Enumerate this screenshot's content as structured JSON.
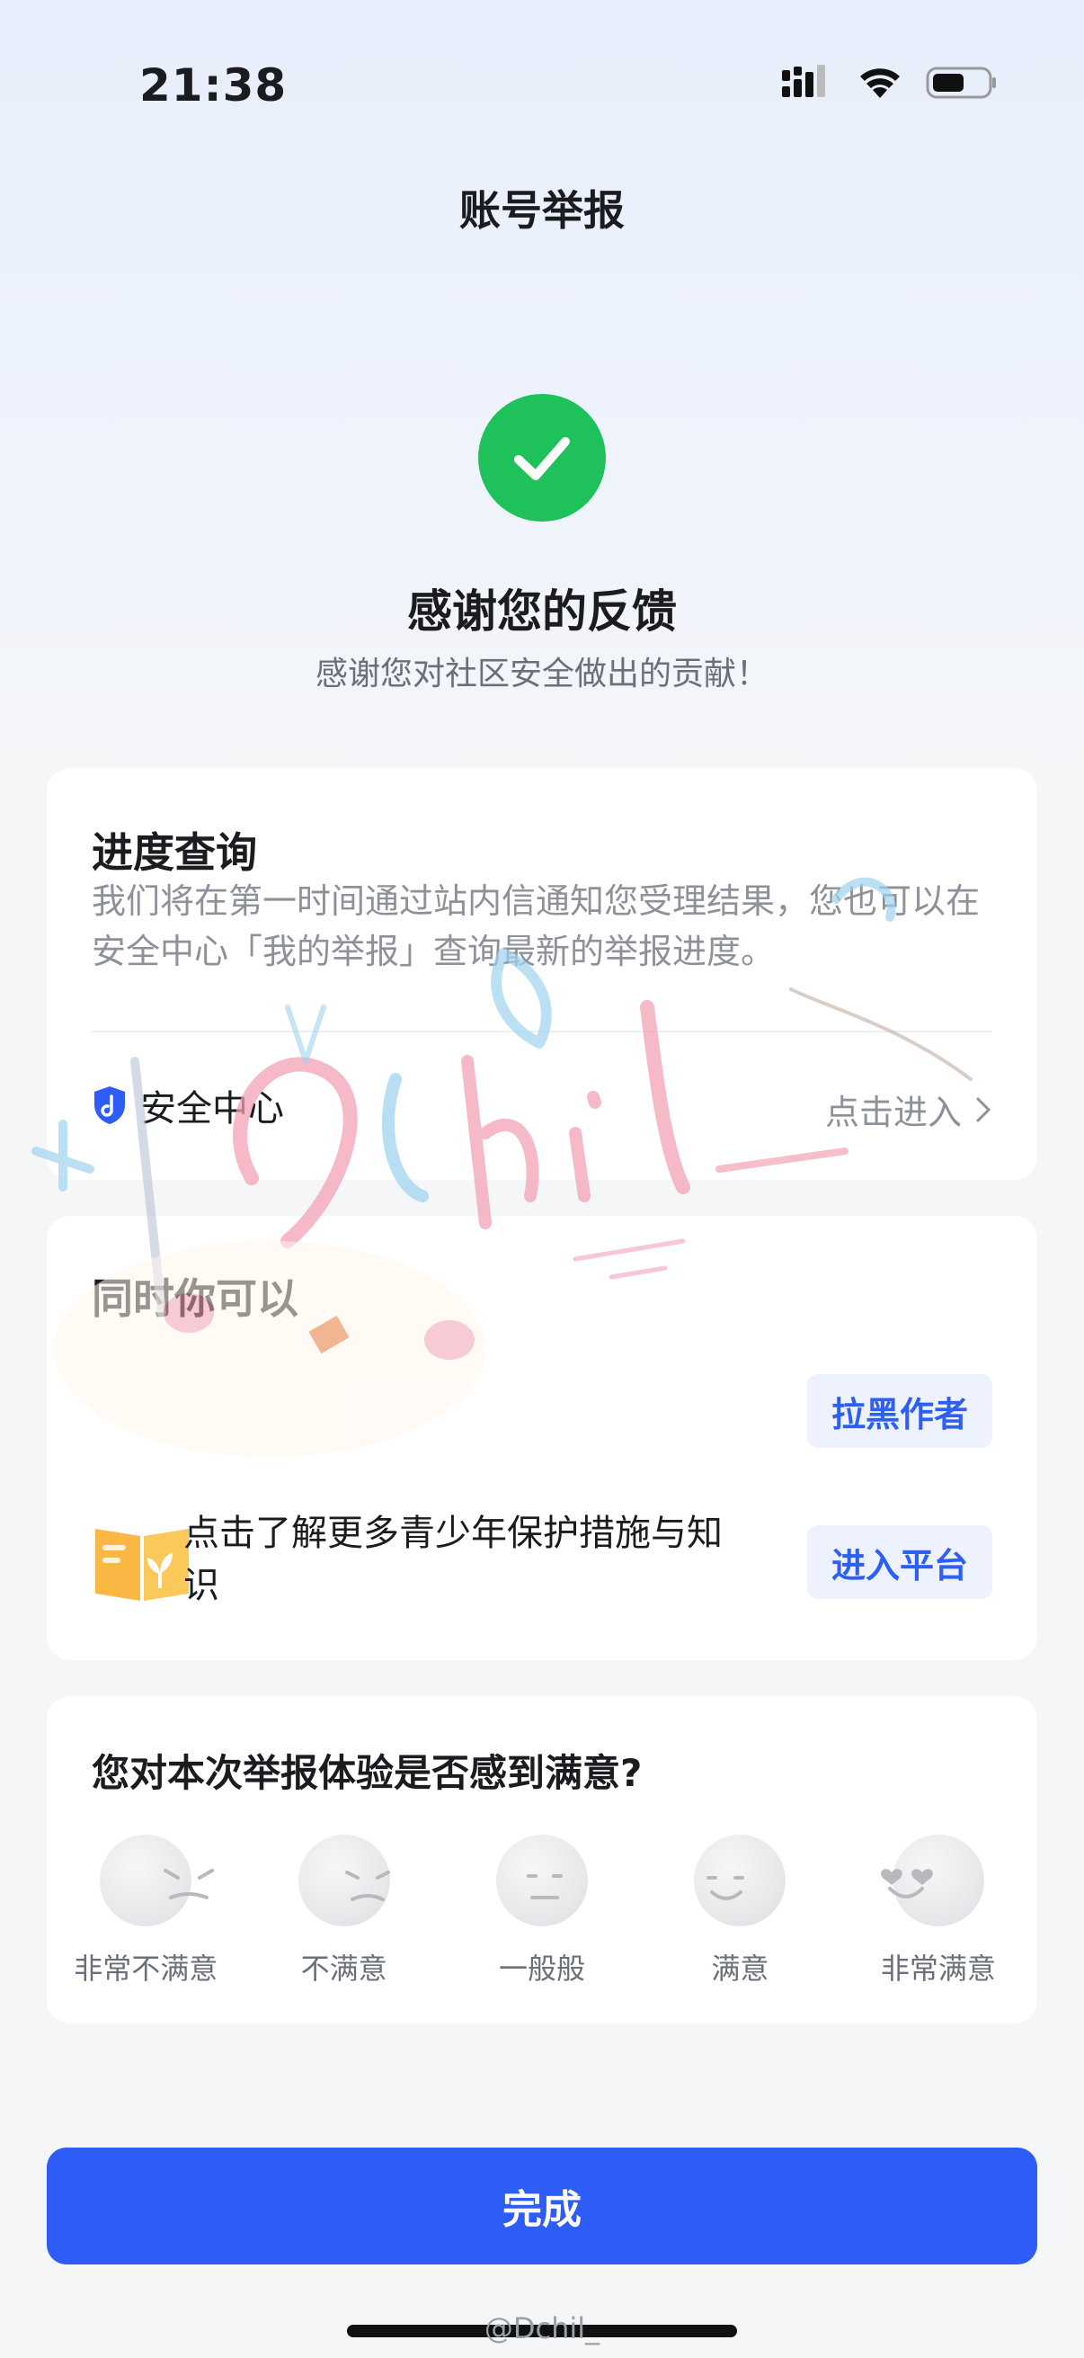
{
  "status_bar": {
    "time": "21:38"
  },
  "nav": {
    "title": "账号举报"
  },
  "result": {
    "title": "感谢您的反馈",
    "subtitle": "感谢您对社区安全做出的贡献！"
  },
  "progress_card": {
    "title": "进度查询",
    "description": "我们将在第一时间通过站内信通知您受理结果，您也可以在安全中心「我的举报」查询最新的举报进度。",
    "security_center_label": "安全中心",
    "enter_label": "点击进入"
  },
  "actions_card": {
    "title": "同时你可以",
    "block_author_label": "拉黑作者",
    "youth_text": "点击了解更多青少年保护措施与知识",
    "enter_platform_label": "进入平台"
  },
  "survey_card": {
    "question": "您对本次举报体验是否感到满意?",
    "options": [
      {
        "label": "非常不满意",
        "icon": "very-dissatisfied-face-icon"
      },
      {
        "label": "不满意",
        "icon": "dissatisfied-face-icon"
      },
      {
        "label": "一般般",
        "icon": "neutral-face-icon"
      },
      {
        "label": "满意",
        "icon": "satisfied-face-icon"
      },
      {
        "label": "非常满意",
        "icon": "very-satisfied-face-icon"
      }
    ]
  },
  "footer": {
    "done_label": "完成"
  },
  "watermark": {
    "credit": "@Dchil_"
  },
  "colors": {
    "success": "#1fc15a",
    "primary": "#2e5cf6",
    "secondary_text": "#8e9199",
    "pill_bg": "#edf2fe"
  }
}
